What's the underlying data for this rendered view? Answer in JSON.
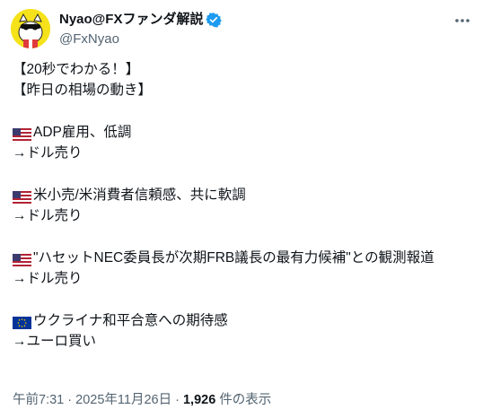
{
  "author": {
    "display_name": "Nyao@FXファンダ解説",
    "handle": "@FxNyao",
    "verified_icon": "verified-badge-icon",
    "accent_color": "#1d9bf0"
  },
  "tweet": {
    "title_line1": "【20秒でわかる！】",
    "title_line2": "【昨日の相場の動き】",
    "items": [
      {
        "flag": "us-flag",
        "text": "ADP雇用、低調",
        "result": "→ドル売り"
      },
      {
        "flag": "us-flag",
        "text": "米小売/米消費者信頼感、共に軟調",
        "result": "→ドル売り"
      },
      {
        "flag": "us-flag",
        "text": "\"ハセットNEC委員長が次期FRB議長の最有力候補\"との観測報道",
        "result": "→ドル売り"
      },
      {
        "flag": "eu-flag",
        "text": "ウクライナ和平合意への期待感",
        "result": "→ユーロ買い"
      }
    ]
  },
  "meta": {
    "time": "午前7:31",
    "separator": "·",
    "date": "2025年11月26日",
    "views_count": "1,926",
    "views_label": "件の表示"
  }
}
